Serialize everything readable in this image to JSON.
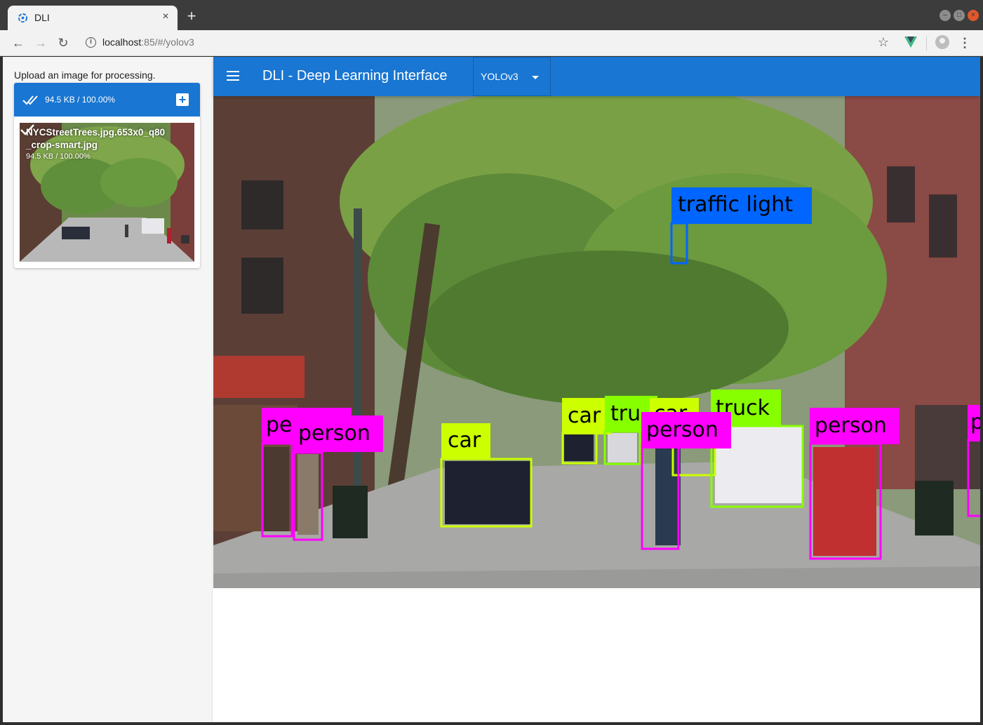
{
  "browser": {
    "tab_title": "DLI",
    "tab_close": "×",
    "new_tab": "+",
    "url_host": "localhost",
    "url_rest": ":85/#/yolov3",
    "back": "←",
    "forward": "→",
    "reload": "↻",
    "star": "☆",
    "menu": "⋮",
    "info": "i"
  },
  "sidebar": {
    "upload_label": "Upload an image for processing.",
    "uploader_status": "94.5 KB / 100.00%",
    "add": "+",
    "file": {
      "name": "NYCStreetTrees.jpg.653x0_q80_crop-smart.jpg",
      "size": "94.5 KB / 100.00%"
    }
  },
  "appbar": {
    "title": "DLI - Deep Learning Interface",
    "model": "YOLOv3"
  },
  "detections": {
    "traffic_light": "traffic light",
    "person": "person",
    "pe": "pe",
    "car": "car",
    "truck": "truck",
    "tru": "tru",
    "car_partial": "car",
    "p": "p"
  },
  "colors": {
    "accent": "#1976d2",
    "person": "#ff00ff",
    "car": "#ccff00",
    "truck": "#88ff00",
    "traffic_light": "#0066ff"
  },
  "icons": {
    "tab": "dli-favicon-icon",
    "done": "double-check-icon",
    "add": "add-box-icon",
    "file_done": "check-icon",
    "menu": "hamburger-menu-icon",
    "dropdown": "caret-down-icon"
  }
}
